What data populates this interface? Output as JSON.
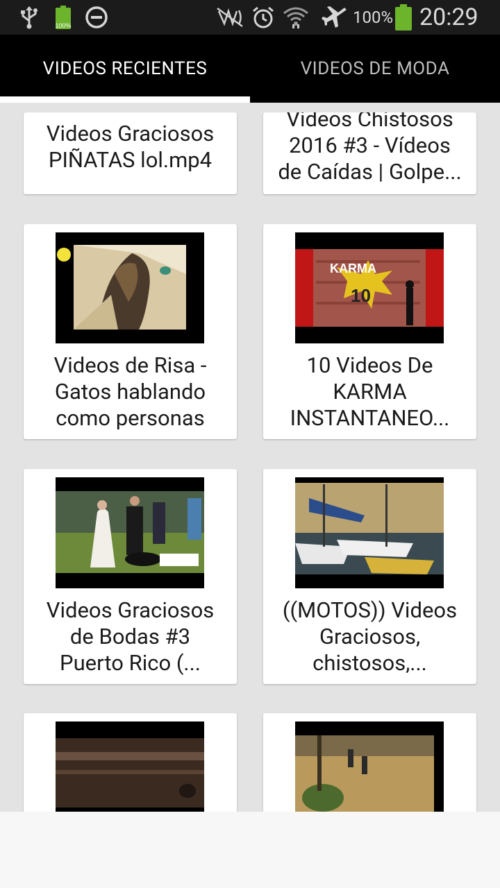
{
  "status_bar": {
    "usb_icon": "usb-icon",
    "battery_small_label": "100%",
    "dnd_icon": "do-not-disturb-icon",
    "nfc_icon": "nfc-muted-icon",
    "alarm_icon": "alarm-icon",
    "wifi_icon": "wifi-icon",
    "airplane_icon": "airplane-mode-icon",
    "battery_percent": "100%",
    "time": "20:29",
    "battery_color": "#6bb42b"
  },
  "tabs": [
    {
      "label": "VIDEOS RECIENTES",
      "active": true
    },
    {
      "label": "VIDEOS DE MODA",
      "active": false
    }
  ],
  "videos": [
    {
      "title_lines": [
        "Videos Graciosos",
        "PIÑATAS lol.mp4"
      ]
    },
    {
      "title_lines": [
        "Videos Chistosos",
        "2016 #3 - Vídeos",
        "de Caídas | Golpe..."
      ]
    },
    {
      "title_lines": [
        "Videos de Risa -",
        "Gatos hablando",
        "como personas"
      ]
    },
    {
      "title_lines": [
        "10 Videos De",
        "KARMA",
        "INSTANTANEO..."
      ]
    },
    {
      "title_lines": [
        "Videos Graciosos",
        "de Bodas #3",
        "Puerto Rico (..."
      ]
    },
    {
      "title_lines": [
        "((MOTOS)) Videos",
        "Graciosos,",
        "chistosos,..."
      ]
    },
    {
      "title_lines": []
    },
    {
      "title_lines": []
    }
  ],
  "thumbnail_text": {
    "karma_word": "KARMA",
    "karma_number": "10"
  }
}
